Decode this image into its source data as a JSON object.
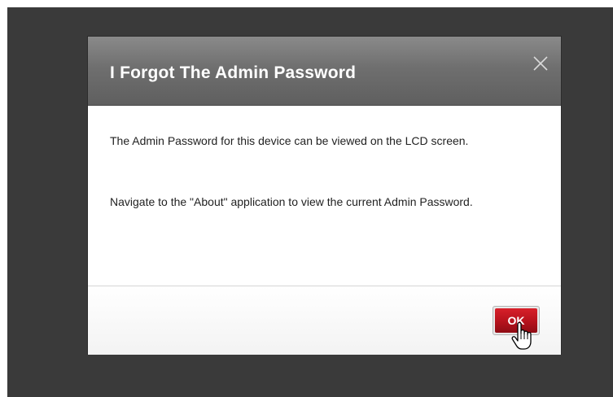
{
  "dialog": {
    "title": "I Forgot The Admin Password",
    "close_icon": "close-icon",
    "messages": [
      "The Admin Password for this device can be viewed on the LCD screen.",
      "Navigate to the \"About\" application to view the current Admin Password."
    ],
    "ok_label": "OK"
  },
  "colors": {
    "backdrop": "#3a3a3a",
    "header": "#6f6f6f",
    "ok_button": "#b5121c"
  },
  "cursor_icon": "hand-pointer-icon"
}
